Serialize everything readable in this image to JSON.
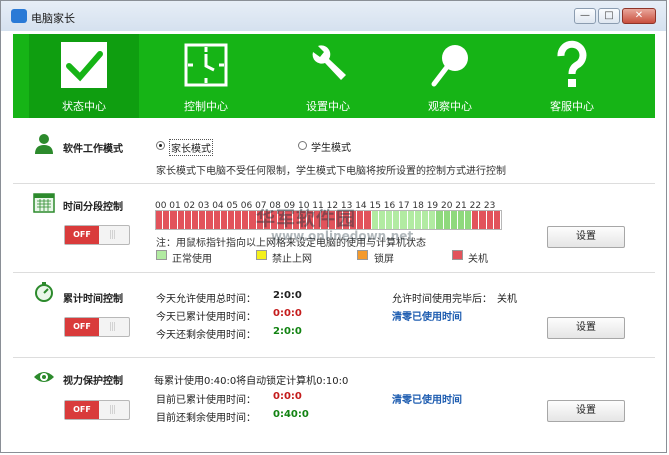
{
  "window": {
    "title": "电脑家长",
    "minimize": "—",
    "maximize": "□",
    "close": "✕"
  },
  "nav": [
    {
      "label": "状态中心",
      "icon": "checkmark-icon"
    },
    {
      "label": "控制中心",
      "icon": "clock-icon"
    },
    {
      "label": "设置中心",
      "icon": "wrench-icon"
    },
    {
      "label": "观察中心",
      "icon": "magnifier-icon"
    },
    {
      "label": "客服中心",
      "icon": "question-icon"
    }
  ],
  "mode": {
    "title": "软件工作模式",
    "option_parent": "家长模式",
    "option_student": "学生模式",
    "selected": "家长模式",
    "description": "家长模式下电脑不受任何限制，学生模式下电脑将按所设置的控制方式进行控制"
  },
  "timeslot": {
    "title": "时间分段控制",
    "toggle": "OFF",
    "hours": [
      "00",
      "01",
      "02",
      "03",
      "04",
      "05",
      "06",
      "07",
      "08",
      "09",
      "10",
      "11",
      "12",
      "13",
      "14",
      "15",
      "16",
      "17",
      "18",
      "19",
      "20",
      "21",
      "22",
      "23"
    ],
    "note": "注：用鼠标指针指向以上网格来设定电脑的使用与计算机状态",
    "legend": [
      {
        "label": "正常使用",
        "color": "#b2eba2"
      },
      {
        "label": "禁止上网",
        "color": "#f4f01c"
      },
      {
        "label": "锁屏",
        "color": "#f49a2c"
      },
      {
        "label": "关机",
        "color": "#e2535b"
      }
    ],
    "settings_button": "设置"
  },
  "cumulative": {
    "title": "累计时间控制",
    "toggle": "OFF",
    "allowed_label": "今天允许使用总时间：",
    "allowed_value": "2:0:0",
    "used_label": "今天已累计使用时间：",
    "used_value": "0:0:0",
    "remaining_label": "今天还剩余使用时间：",
    "remaining_value": "2:0:0",
    "after_label": "允许时间使用完毕后：",
    "after_value": "关机",
    "clear_link": "清零已使用时间",
    "settings_button": "设置"
  },
  "eye": {
    "title": "视力保护控制",
    "toggle": "OFF",
    "rule_text": "每累计使用0:40:0将自动锁定计算机0:10:0",
    "used_label": "目前已累计使用时间：",
    "used_value": "0:0:0",
    "remaining_label": "目前还剩余使用时间：",
    "remaining_value": "0:40:0",
    "clear_link": "清零已使用时间",
    "settings_button": "设置"
  },
  "watermark": {
    "line1": "华军软件园",
    "line2": "www.onlinedown.net"
  },
  "colors": {
    "nav_green": "#16b416",
    "slot_off": "#e2535b",
    "slot_on": "#b2eba2",
    "slot_hover": "#8fd97d"
  }
}
